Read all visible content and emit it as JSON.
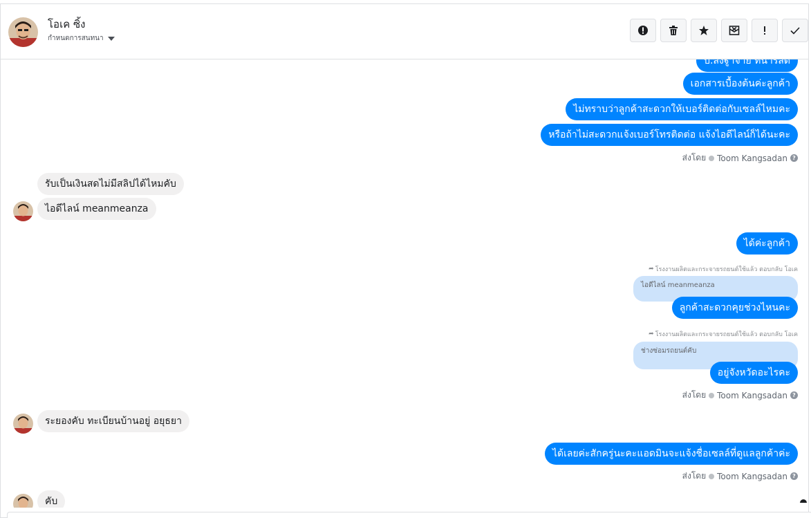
{
  "header": {
    "name": "โอเค ซิ้ง",
    "subtitle": "กำหนดการสนทนา",
    "actions": [
      {
        "name": "spam-button",
        "icon": "exclamation-circle-icon"
      },
      {
        "name": "delete-button",
        "icon": "trash-icon"
      },
      {
        "name": "star-button",
        "icon": "star-icon"
      },
      {
        "name": "mark-unread-button",
        "icon": "envelope-x-icon"
      },
      {
        "name": "important-button",
        "icon": "exclamation-icon"
      },
      {
        "name": "done-button",
        "icon": "check-icon"
      }
    ]
  },
  "messages": {
    "out_cut": "บ.สงฐู่าจ่าย ทน้ารสดิ",
    "out1": "เอกสารเบื้องต้นค่ะลูกค้า",
    "out2": "ไม่ทราบว่าลูกค้าสะดวกให้เบอร์ติดต่อกับเซลล์ไหมคะ",
    "out3": "หรือถ้าไม่สะดวกแจ้งเบอร์โทรติดต่อ แจ้งไอดีไลน์ก็ได้นะคะ",
    "sent1_prefix": "ส่งโดย",
    "sent1_agent": "Toom Kangsadan",
    "in1": "รับเป็นเงินสดไม่มีสลิปได้ไหมคับ",
    "in2": "ไอดีไลน์ meanmeanza",
    "out4": "ได้ค่ะลูกค้า",
    "reply1_note": "โรงงานผลิตและกระจายรถยนต์ใช้แล้ว ตอบกลับ โอเค",
    "reply1_quote": "ไอดีไลน์ meanmeanza",
    "out5": "ลูกค้าสะดวกคุยช่วงไหนคะ",
    "reply2_note": "โรงงานผลิตและกระจายรถยนต์ใช้แล้ว ตอบกลับ โอเค",
    "reply2_quote": "ช่างซ่อมรถยนต์คับ",
    "out6": "อยู่จังหวัดอะไรคะ",
    "sent2_prefix": "ส่งโดย",
    "sent2_agent": "Toom Kangsadan",
    "in3": "ระยองคับ ทะเบียนบ้านอยู่ อยุธยา",
    "out7": "ได้เลยค่ะสักครู่นะคะแอดมินจะแจ้งชื่อเซลล์ที่ดูแลลูกค้าค่ะ",
    "sent3_prefix": "ส่งโดย",
    "sent3_agent": "Toom Kangsadan",
    "in4": "คับ"
  },
  "colors": {
    "outgoing": "#0084ff",
    "incoming": "#f1f0f0",
    "quote": "#cde3fb"
  }
}
